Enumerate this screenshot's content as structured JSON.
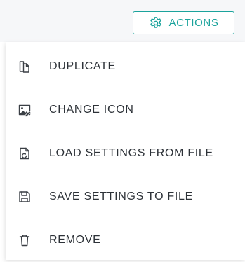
{
  "actions_button": {
    "label": "ACTIONS",
    "icon": "gear-icon",
    "accent": "#1ba39c"
  },
  "menu": {
    "items": [
      {
        "label": "DUPLICATE",
        "icon": "duplicate-icon"
      },
      {
        "label": "CHANGE ICON",
        "icon": "image-edit-icon"
      },
      {
        "label": "LOAD SETTINGS FROM FILE",
        "icon": "file-load-icon"
      },
      {
        "label": "SAVE SETTINGS TO FILE",
        "icon": "save-icon"
      },
      {
        "label": "REMOVE",
        "icon": "trash-icon"
      }
    ]
  }
}
